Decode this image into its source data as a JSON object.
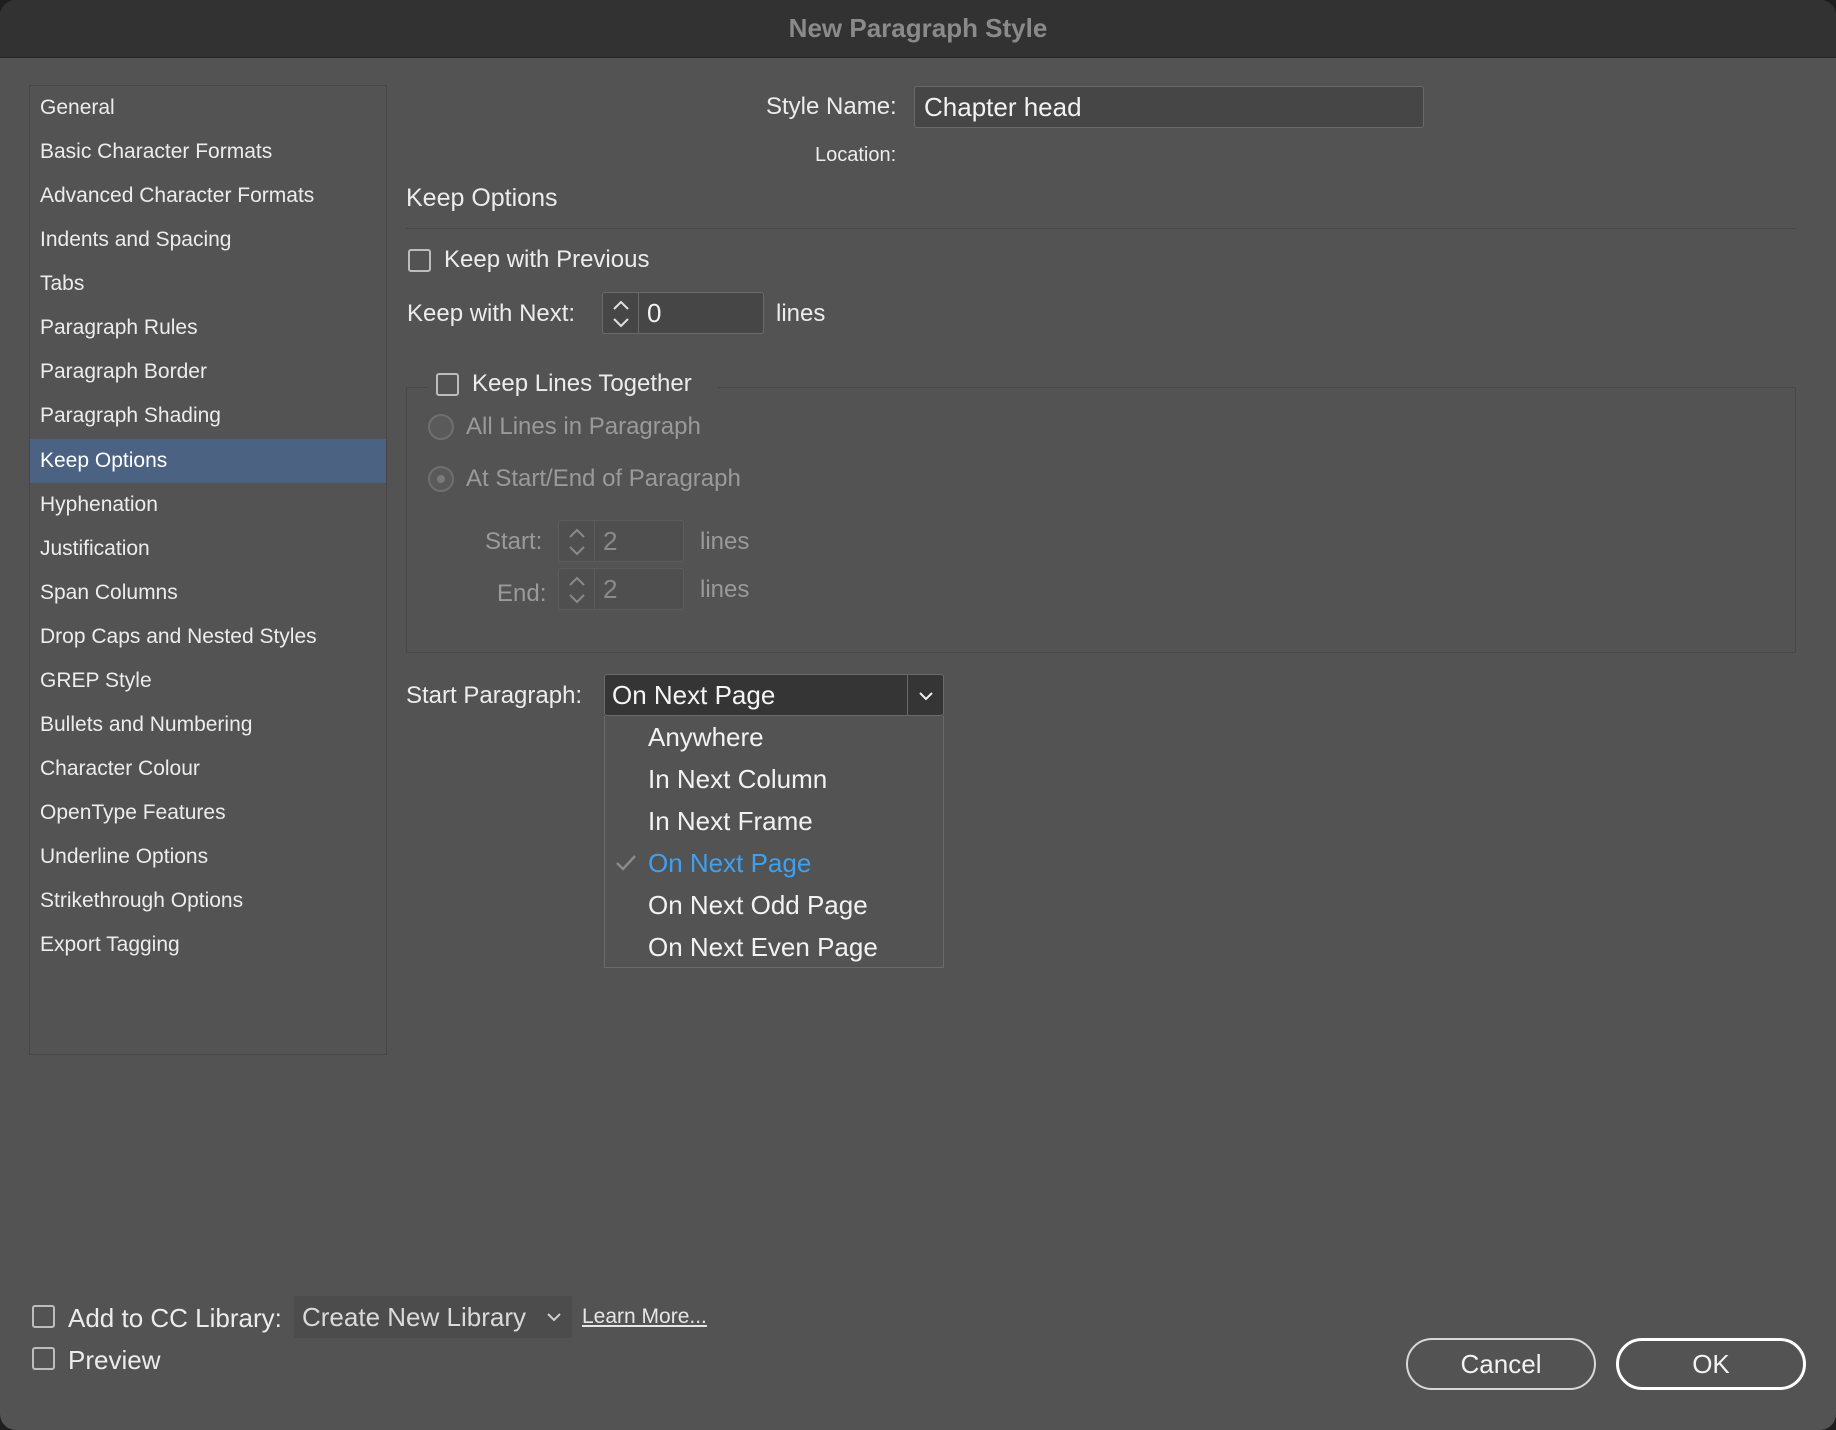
{
  "window": {
    "title": "New Paragraph Style"
  },
  "sidebar": {
    "items": [
      {
        "label": "General"
      },
      {
        "label": "Basic Character Formats"
      },
      {
        "label": "Advanced Character Formats"
      },
      {
        "label": "Indents and Spacing"
      },
      {
        "label": "Tabs"
      },
      {
        "label": "Paragraph Rules"
      },
      {
        "label": "Paragraph Border"
      },
      {
        "label": "Paragraph Shading"
      },
      {
        "label": "Keep Options",
        "active": true
      },
      {
        "label": "Hyphenation"
      },
      {
        "label": "Justification"
      },
      {
        "label": "Span Columns"
      },
      {
        "label": "Drop Caps and Nested Styles"
      },
      {
        "label": "GREP Style"
      },
      {
        "label": "Bullets and Numbering"
      },
      {
        "label": "Character Colour"
      },
      {
        "label": "OpenType Features"
      },
      {
        "label": "Underline Options"
      },
      {
        "label": "Strikethrough Options"
      },
      {
        "label": "Export Tagging"
      }
    ]
  },
  "header": {
    "style_name_label": "Style Name:",
    "style_name_value": "Chapter head",
    "location_label": "Location:",
    "location_value": ""
  },
  "section": {
    "title": "Keep Options"
  },
  "keep_with_previous": {
    "label": "Keep with Previous",
    "checked": false
  },
  "keep_with_next": {
    "label": "Keep with Next:",
    "value": "0",
    "unit": "lines"
  },
  "keep_lines_together": {
    "label": "Keep Lines Together",
    "checked": false,
    "option_all": "All Lines in Paragraph",
    "option_start_end": "At Start/End of Paragraph",
    "start_label": "Start:",
    "start_value": "2",
    "end_label": "End:",
    "end_value": "2",
    "unit": "lines"
  },
  "start_paragraph": {
    "label": "Start Paragraph:",
    "value": "On Next Page",
    "options": [
      {
        "label": "Anywhere"
      },
      {
        "label": "In Next Column"
      },
      {
        "label": "In Next Frame"
      },
      {
        "label": "On Next Page",
        "selected": true
      },
      {
        "label": "On Next Odd Page"
      },
      {
        "label": "On Next Even Page"
      }
    ]
  },
  "footer": {
    "cc_library_label": "Add to CC Library:",
    "cc_library_value": "Create New Library",
    "learn_more": "Learn More...",
    "preview_label": "Preview",
    "cancel": "Cancel",
    "ok": "OK"
  },
  "colors": {
    "dialog_bg": "#535353",
    "titlebar_bg": "#323232",
    "sidebar_active": "#4b6282",
    "selected_text": "#3fa0f0"
  }
}
